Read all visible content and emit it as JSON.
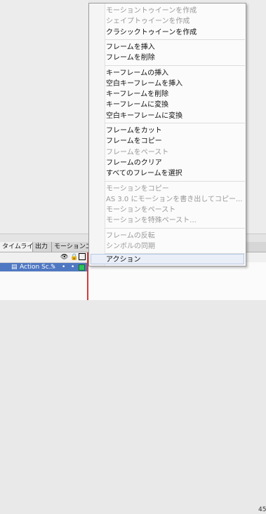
{
  "menu": {
    "items": [
      {
        "label": "モーショントゥイーンを作成",
        "enabled": false
      },
      {
        "label": "シェイプトゥイーンを作成",
        "enabled": false
      },
      {
        "label": "クラシックトゥイーンを作成",
        "enabled": true
      },
      {
        "separator": true
      },
      {
        "label": "フレームを挿入",
        "enabled": true
      },
      {
        "label": "フレームを削除",
        "enabled": true
      },
      {
        "separator": true
      },
      {
        "label": "キーフレームの挿入",
        "enabled": true
      },
      {
        "label": "空白キーフレームを挿入",
        "enabled": true
      },
      {
        "label": "キーフレームを削除",
        "enabled": true
      },
      {
        "label": "キーフレームに変換",
        "enabled": true
      },
      {
        "label": "空白キーフレームに変換",
        "enabled": true
      },
      {
        "separator": true
      },
      {
        "label": "フレームをカット",
        "enabled": true
      },
      {
        "label": "フレームをコピー",
        "enabled": true
      },
      {
        "label": "フレームをペースト",
        "enabled": false
      },
      {
        "label": "フレームのクリア",
        "enabled": true
      },
      {
        "label": "すべてのフレームを選択",
        "enabled": true
      },
      {
        "separator": true
      },
      {
        "label": "モーションをコピー",
        "enabled": false
      },
      {
        "label": "AS 3.0 にモーションを書き出してコピー...",
        "enabled": false
      },
      {
        "label": "モーションをペースト",
        "enabled": false
      },
      {
        "label": "モーションを特殊ペースト...",
        "enabled": false
      },
      {
        "separator": true
      },
      {
        "label": "フレームの反転",
        "enabled": false
      },
      {
        "label": "シンボルの同期",
        "enabled": false
      },
      {
        "separator": true
      },
      {
        "label": "アクション",
        "enabled": true,
        "highlighted": true
      }
    ]
  },
  "timeline": {
    "tabs": [
      "タイムライン",
      "出力",
      "モーションエディタ"
    ],
    "active_tab": 0,
    "layer_name": "Action Sc...",
    "frame_number_visible": "45"
  }
}
